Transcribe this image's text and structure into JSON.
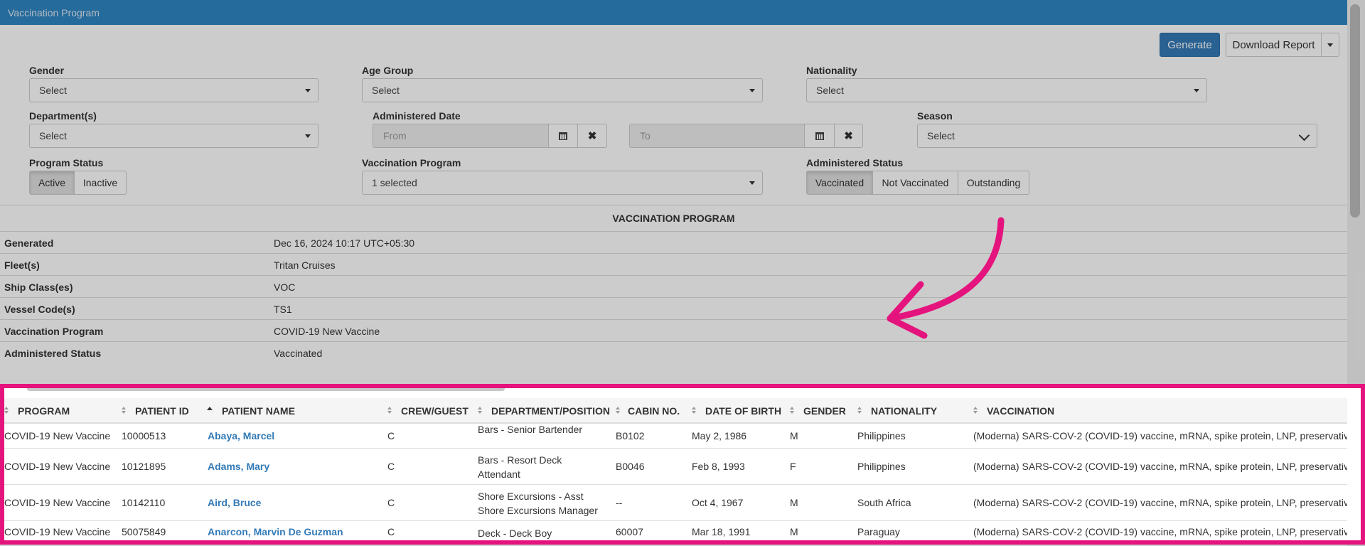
{
  "window": {
    "title": "Vaccination Program"
  },
  "toolbar": {
    "generate_label": "Generate",
    "download_label": "Download Report"
  },
  "filters": {
    "gender": {
      "label": "Gender",
      "value": "Select"
    },
    "age_group": {
      "label": "Age Group",
      "value": "Select"
    },
    "nationality": {
      "label": "Nationality",
      "value": "Select"
    },
    "departments": {
      "label": "Department(s)",
      "value": "Select"
    },
    "administered_date": {
      "label": "Administered Date",
      "from_placeholder": "From",
      "to_placeholder": "To"
    },
    "season": {
      "label": "Season",
      "value": "Select"
    },
    "program_status": {
      "label": "Program Status",
      "options": [
        "Active",
        "Inactive"
      ],
      "selected": "Active"
    },
    "vaccination_program": {
      "label": "Vaccination Program",
      "value": "1 selected"
    },
    "administered_status": {
      "label": "Administered Status",
      "options": [
        "Vaccinated",
        "Not Vaccinated",
        "Outstanding"
      ],
      "selected": "Vaccinated"
    }
  },
  "report": {
    "title": "VACCINATION PROGRAM",
    "info": [
      {
        "label": "Generated",
        "value": "Dec 16, 2024 10:17 UTC+05:30"
      },
      {
        "label": "Fleet(s)",
        "value": "Tritan Cruises"
      },
      {
        "label": "Ship Class(es)",
        "value": "VOC"
      },
      {
        "label": "Vessel Code(s)",
        "value": "TS1"
      },
      {
        "label": "Vaccination Program",
        "value": "COVID-19 New Vaccine"
      },
      {
        "label": "Administered Status",
        "value": "Vaccinated"
      }
    ]
  },
  "table": {
    "columns": [
      "PROGRAM",
      "PATIENT ID",
      "PATIENT NAME",
      "CREW/GUEST",
      "DEPARTMENT/POSITION",
      "CABIN NO.",
      "DATE OF BIRTH",
      "GENDER",
      "NATIONALITY",
      "VACCINATION"
    ],
    "sorted_column": "PATIENT NAME",
    "rows": [
      {
        "program": "COVID-19 New Vaccine",
        "patient_id": "10000513",
        "patient_name": "Abaya, Marcel",
        "crew_guest": "C",
        "department": "Bars - Senior Bartender",
        "cabin": "B0102",
        "dob": "May 2, 1986",
        "gender": "M",
        "nationality": "Philippines",
        "vaccination": "(Moderna) SARS-COV-2 (COVID-19) vaccine, mRNA, spike protein, LNP, preservativ"
      },
      {
        "program": "COVID-19 New Vaccine",
        "patient_id": "10121895",
        "patient_name": "Adams, Mary",
        "crew_guest": "C",
        "department": "Bars - Resort Deck Attendant",
        "cabin": "B0046",
        "dob": "Feb 8, 1993",
        "gender": "F",
        "nationality": "Philippines",
        "vaccination": "(Moderna) SARS-COV-2 (COVID-19) vaccine, mRNA, spike protein, LNP, preservativ"
      },
      {
        "program": "COVID-19 New Vaccine",
        "patient_id": "10142110",
        "patient_name": "Aird, Bruce",
        "crew_guest": "C",
        "department": "Shore Excursions - Asst Shore Excursions Manager",
        "cabin": "--",
        "dob": "Oct 4, 1967",
        "gender": "M",
        "nationality": "South Africa",
        "vaccination": "(Moderna) SARS-COV-2 (COVID-19) vaccine, mRNA, spike protein, LNP, preservativ"
      },
      {
        "program": "COVID-19 New Vaccine",
        "patient_id": "50075849",
        "patient_name": "Anarcon, Marvin De Guzman",
        "crew_guest": "C",
        "department": "Deck - Deck Boy",
        "cabin": "60007",
        "dob": "Mar 18, 1991",
        "gender": "M",
        "nationality": "Paraguay",
        "vaccination": "(Moderna) SARS-COV-2 (COVID-19) vaccine, mRNA, spike protein, LNP, preservativ"
      }
    ]
  },
  "annotation": {
    "highlight_color": "#e5137d"
  }
}
